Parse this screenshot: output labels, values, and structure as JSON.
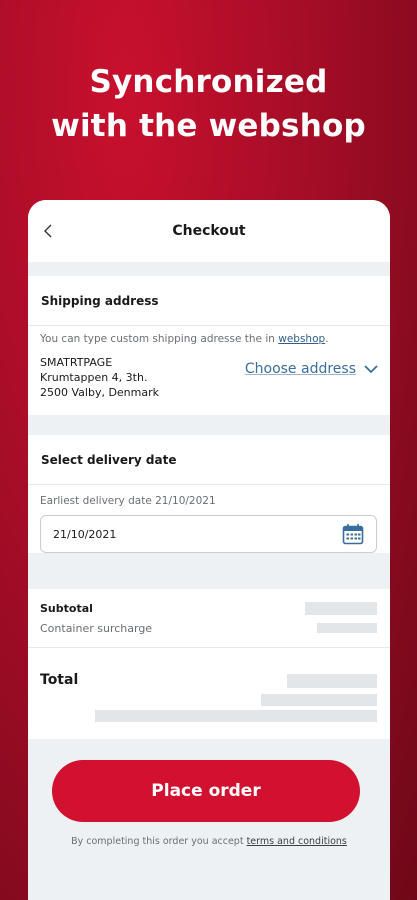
{
  "hero": {
    "line1": "Synchronized",
    "line2": "with the webshop"
  },
  "header": {
    "title": "Checkout",
    "back_icon": "chevron-left-icon"
  },
  "shipping": {
    "heading": "Shipping address",
    "note_prefix": "You can type custom shipping adresse the in ",
    "note_link": "webshop",
    "note_suffix": ".",
    "address_lines": [
      "SMATRTPAGE",
      "Krumtappen 4, 3th.",
      "2500 Valby, Denmark"
    ],
    "choose_label": "Choose address",
    "choose_icon": "chevron-down-icon"
  },
  "delivery": {
    "heading": "Select delivery date",
    "earliest": "Earliest delivery date 21/10/2021",
    "date_value": "21/10/2021",
    "calendar_icon": "calendar-icon"
  },
  "summary": {
    "subtotal_label": "Subtotal",
    "surcharge_label": "Container surcharge",
    "total_label": "Total"
  },
  "actions": {
    "place_order": "Place order",
    "legal_prefix": "By completing this order you accept ",
    "legal_link": "terms and conditions"
  },
  "colors": {
    "brand": "#d2102f",
    "link": "#3a6e9c"
  }
}
